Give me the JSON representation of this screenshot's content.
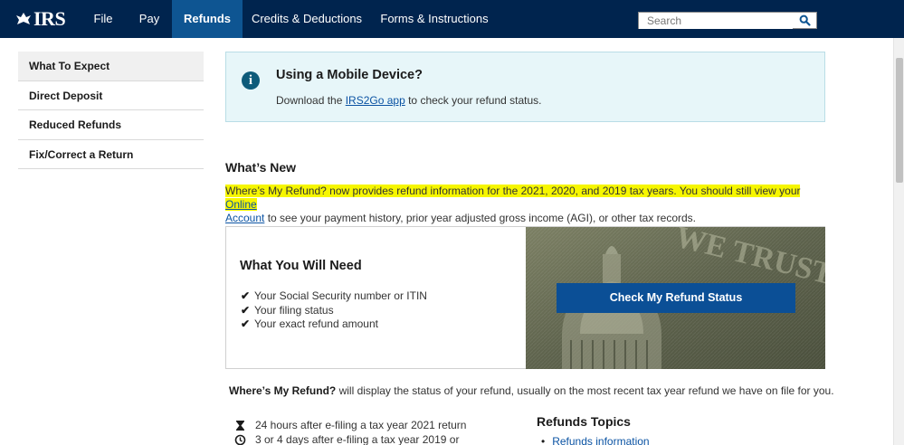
{
  "header": {
    "logo_text": "IRS",
    "nav": [
      {
        "label": "File",
        "active": false
      },
      {
        "label": "Pay",
        "active": false
      },
      {
        "label": "Refunds",
        "active": true
      },
      {
        "label": "Credits & Deductions",
        "active": false
      },
      {
        "label": "Forms & Instructions",
        "active": false
      }
    ],
    "search_placeholder": "Search",
    "search_icon": "search-icon"
  },
  "sidebar": {
    "items": [
      {
        "label": "What To Expect",
        "active": true
      },
      {
        "label": "Direct Deposit",
        "active": false
      },
      {
        "label": "Reduced Refunds",
        "active": false
      },
      {
        "label": "Fix/Correct a Return",
        "active": false
      }
    ]
  },
  "mobile_box": {
    "icon": "info-icon",
    "title": "Using a Mobile Device?",
    "text_before": "Download the ",
    "link": "IRS2Go app",
    "text_after": " to check your refund status."
  },
  "whats_new": {
    "heading": "What’s New",
    "highlighted_text": "Where’s My Refund? now provides refund information for the 2021, 2020, and 2019 tax years. You should still view your ",
    "link_part1": "Online",
    "link_part2": "Account",
    "text_after": " to see your payment history, prior year adjusted gross income (AGI), or other tax records."
  },
  "needs": {
    "title": "What You Will Need",
    "items": [
      "Your Social Security number or ITIN",
      "Your filing status",
      "Your exact refund amount"
    ],
    "button": "Check My Refund Status"
  },
  "status": {
    "bold": "Where’s My Refund?",
    "rest": " will display the status of your refund, usually on the most recent tax year refund we have on file for you."
  },
  "timing": [
    {
      "icon": "hourglass-icon",
      "text": "24 hours after e-filing a tax year 2021 return"
    },
    {
      "icon": "clock-icon",
      "text": "3 or 4 days after e-filing a tax year 2019 or"
    }
  ],
  "topics": {
    "title": "Refunds Topics",
    "items": [
      "Refunds information"
    ]
  },
  "colors": {
    "nav_bg": "#00244e",
    "nav_active": "#0e5592",
    "button": "#0b4f96",
    "highlight": "#f6f600",
    "info_bg": "#e7f6f9"
  }
}
